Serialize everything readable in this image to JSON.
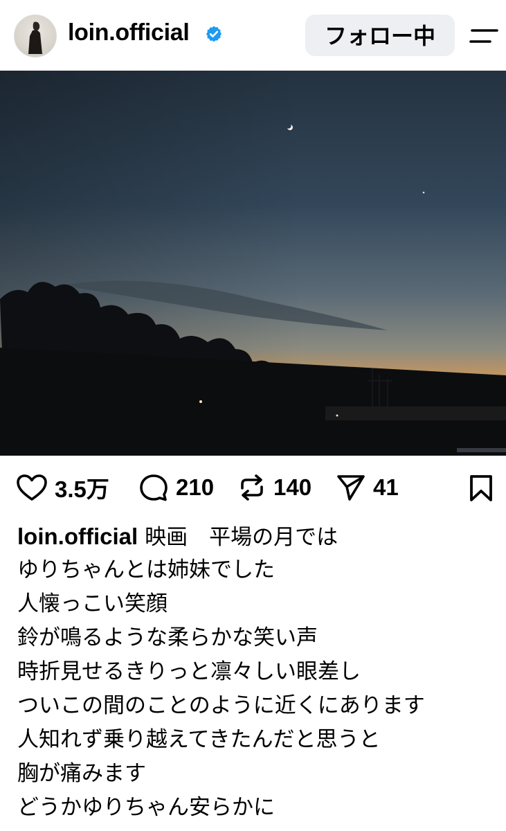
{
  "header": {
    "username": "loin.official",
    "follow_label": "フォロー中"
  },
  "post": {
    "image_alt": "",
    "actions": {
      "likes": "3.5万",
      "comments": "210",
      "reposts": "140",
      "shares": "41"
    },
    "caption": {
      "username": "loin.official",
      "lines": [
        "映画　平場の月では",
        "ゆりちゃんとは姉妹でした",
        "人懐っこい笑顔",
        "鈴が鳴るような柔らかな笑い声",
        "時折見せるきりっと凛々しい眼差し",
        "ついこの間のことのように近くにあります",
        "人知れず乗り越えてきたんだと思うと",
        "胸が痛みます",
        "どうかゆりちゃん安らかに"
      ]
    }
  },
  "colors": {
    "verified": "#1d9bf0",
    "follow_bg": "#eeeff2",
    "sky_top": "#263340",
    "sky_horizon": "#f3a34c"
  },
  "icons": [
    "verified-badge-icon",
    "menu-icon",
    "heart-icon",
    "comment-icon",
    "repost-icon",
    "send-icon",
    "bookmark-icon"
  ]
}
